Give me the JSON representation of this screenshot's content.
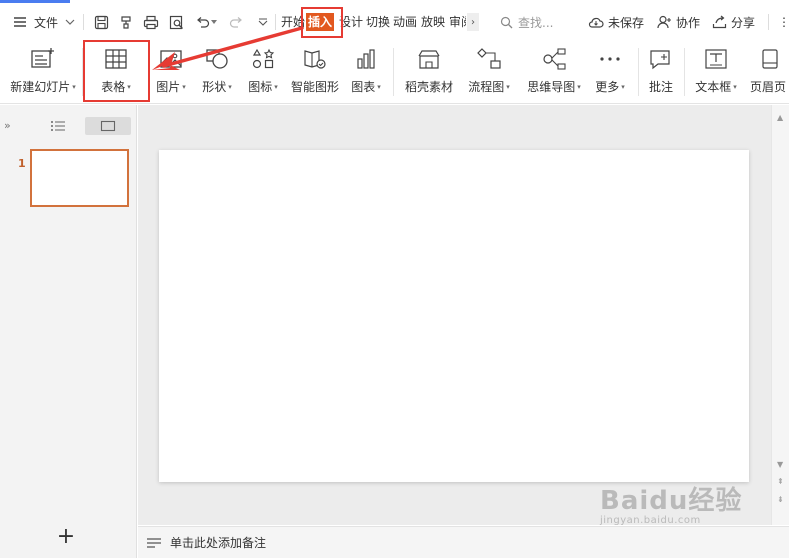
{
  "topbar": {
    "menu_label": "文件",
    "tabs": [
      {
        "label": "开始",
        "active": false
      },
      {
        "label": "插入",
        "active": true
      },
      {
        "label": "设计",
        "active": false
      },
      {
        "label": "切换",
        "active": false
      },
      {
        "label": "动画",
        "active": false
      },
      {
        "label": "放映",
        "active": false
      },
      {
        "label": "审阅",
        "active": false
      }
    ],
    "more_tabs": "›",
    "search_placeholder": "查找...",
    "unsaved_label": "未保存",
    "collab_label": "协作",
    "share_label": "分享",
    "overflow": "⋮"
  },
  "ribbon": {
    "new_slide": "新建幻灯片",
    "table": "表格",
    "picture": "图片",
    "shape": "形状",
    "icon": "图标",
    "smartart": "智能图形",
    "chart": "图表",
    "daoke_material": "稻壳素材",
    "flowchart": "流程图",
    "mindmap": "思维导图",
    "more": "更多",
    "comment": "批注",
    "textbox": "文本框",
    "header_footer": "页眉页"
  },
  "slides_panel": {
    "slide_number": "1",
    "add_slide": "+"
  },
  "notes": {
    "placeholder": "单击此处添加备注"
  },
  "watermark": {
    "main": "Baidu经验",
    "sub": "jingyan.baidu.com"
  },
  "colors": {
    "accent": "#e2581f",
    "highlight_border": "#e63b33",
    "selection_border": "#d2723c"
  }
}
